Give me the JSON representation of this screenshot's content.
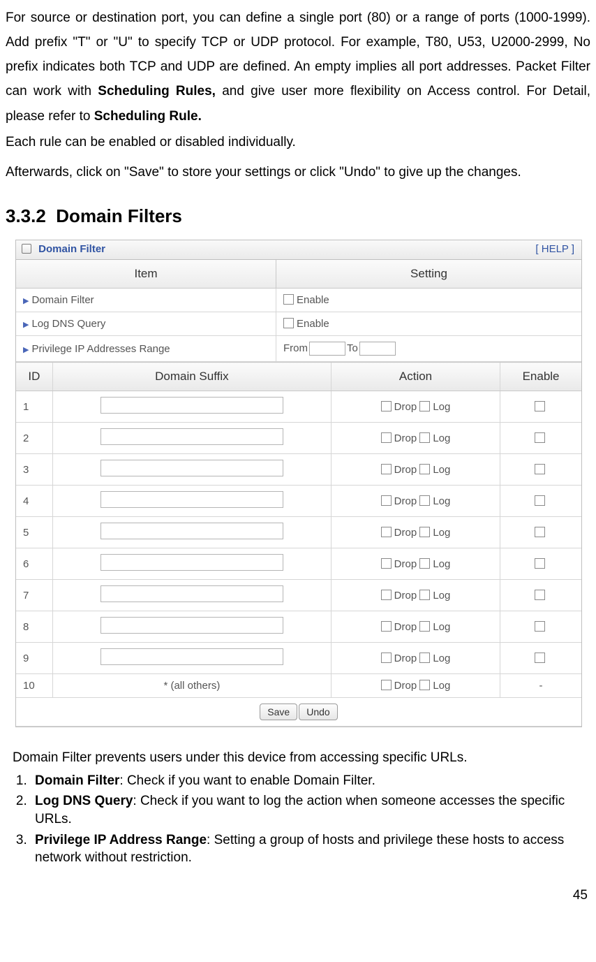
{
  "intro": {
    "p1a": "For source or destination port, you can define a single port (80) or a range of ports (1000-1999). Add prefix \"T\" or \"U\" to specify TCP or UDP protocol. For example, T80, U53, U2000-2999, No prefix indicates both TCP and UDP are defined. An empty implies all port addresses. Packet Filter can work with ",
    "p1bold1": "Scheduling Rules,",
    "p1b": " and give user more flexibility on Access control. For Detail, please refer to ",
    "p1bold2": "Scheduling Rule.",
    "p2": "Each rule can be enabled or disabled individually.",
    "p3": "Afterwards, click on \"Save\" to store your settings or click \"Undo\" to give up the changes."
  },
  "section": {
    "number": "3.3.2",
    "title": "Domain Filters"
  },
  "panel": {
    "title": "Domain Filter",
    "help": "[ HELP ]",
    "headers": {
      "item": "Item",
      "setting": "Setting"
    },
    "rows": {
      "domainFilter": {
        "label": "Domain Filter",
        "enable": "Enable"
      },
      "logDns": {
        "label": "Log DNS Query",
        "enable": "Enable"
      },
      "ipRange": {
        "label": "Privilege IP Addresses Range",
        "from": "From",
        "to": "To"
      }
    },
    "rulesHeaders": {
      "id": "ID",
      "suffix": "Domain Suffix",
      "action": "Action",
      "enable": "Enable"
    },
    "actionLabels": {
      "drop": "Drop",
      "log": "Log"
    },
    "rules": [
      {
        "id": "1",
        "suffixType": "input"
      },
      {
        "id": "2",
        "suffixType": "input"
      },
      {
        "id": "3",
        "suffixType": "input"
      },
      {
        "id": "4",
        "suffixType": "input"
      },
      {
        "id": "5",
        "suffixType": "input"
      },
      {
        "id": "6",
        "suffixType": "input"
      },
      {
        "id": "7",
        "suffixType": "input"
      },
      {
        "id": "8",
        "suffixType": "input"
      },
      {
        "id": "9",
        "suffixType": "input"
      },
      {
        "id": "10",
        "suffixType": "text",
        "suffixText": "* (all others)",
        "enableText": "-"
      }
    ],
    "buttons": {
      "save": "Save",
      "undo": "Undo"
    }
  },
  "desc": {
    "lead": "Domain Filter prevents users under this device from accessing specific URLs.",
    "items": [
      {
        "bold": "Domain Filter",
        "rest": ": Check if you want to enable Domain Filter."
      },
      {
        "bold": "Log DNS Query",
        "rest": ": Check if you want to log the action when someone accesses the specific URLs."
      },
      {
        "bold": "Privilege IP Address Range",
        "rest": ": Setting a group of hosts and privilege these hosts to access network without restriction."
      }
    ]
  },
  "pageNumber": "45"
}
